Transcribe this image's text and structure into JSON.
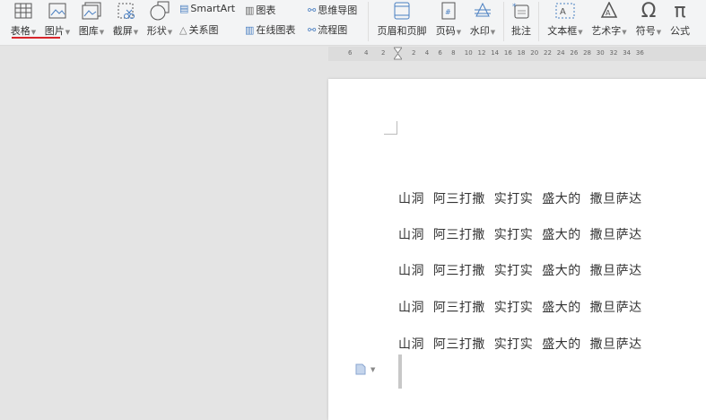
{
  "ribbon": {
    "table": "表格",
    "picture": "图片",
    "gallery": "图库",
    "screenshot": "截屏",
    "shape": "形状",
    "smartart": "SmartArt",
    "relation": "关系图",
    "chart": "图表",
    "online_chart": "在线图表",
    "mindmap": "思维导图",
    "flowchart": "流程图",
    "header_footer": "页眉和页脚",
    "page_number": "页码",
    "watermark": "水印",
    "comment": "批注",
    "textbox": "文本框",
    "wordart": "艺术字",
    "symbol": "符号",
    "formula": "公式"
  },
  "ruler": {
    "left": [
      "6",
      "4",
      "2"
    ],
    "right": [
      "2",
      "4",
      "6",
      "8",
      "10",
      "12",
      "14",
      "16",
      "18",
      "20",
      "22",
      "24",
      "26",
      "28",
      "30",
      "32",
      "34",
      "36"
    ]
  },
  "document": {
    "lines": [
      "山洞  阿三打撒  实打实  盛大的  撒旦萨达",
      "山洞  阿三打撒  实打实  盛大的  撒旦萨达",
      "山洞  阿三打撒  实打实  盛大的  撒旦萨达",
      "山洞  阿三打撒  实打实  盛大的  撒旦萨达",
      "山洞  阿三打撒  实打实  盛大的  撒旦萨达"
    ]
  },
  "colors": {
    "accent": "#d8262c",
    "icon": "#4a7fc1"
  }
}
